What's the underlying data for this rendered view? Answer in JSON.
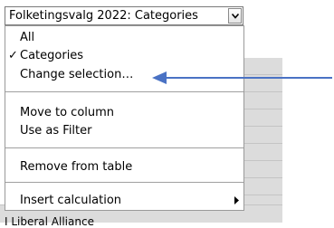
{
  "dropdown": {
    "selected_value": "Folketingsvalg 2022: Categories",
    "button_icon": "chevron-down-icon"
  },
  "menu": {
    "items": [
      {
        "label": "All",
        "checked": false
      },
      {
        "label": "Categories",
        "checked": true,
        "check_glyph": "✓"
      },
      {
        "label": "Change selection…",
        "checked": false
      },
      {
        "label": "Move to column",
        "checked": false
      },
      {
        "label": "Use as Filter",
        "checked": false
      },
      {
        "label": "Remove from table",
        "checked": false
      },
      {
        "label": "Insert calculation",
        "checked": false,
        "has_submenu": true
      }
    ]
  },
  "background_table": {
    "partial_row_text": "I  Liberal Alliance"
  },
  "annotation": {
    "arrow_color": "#4a72c4",
    "points_to": "Change selection…"
  }
}
